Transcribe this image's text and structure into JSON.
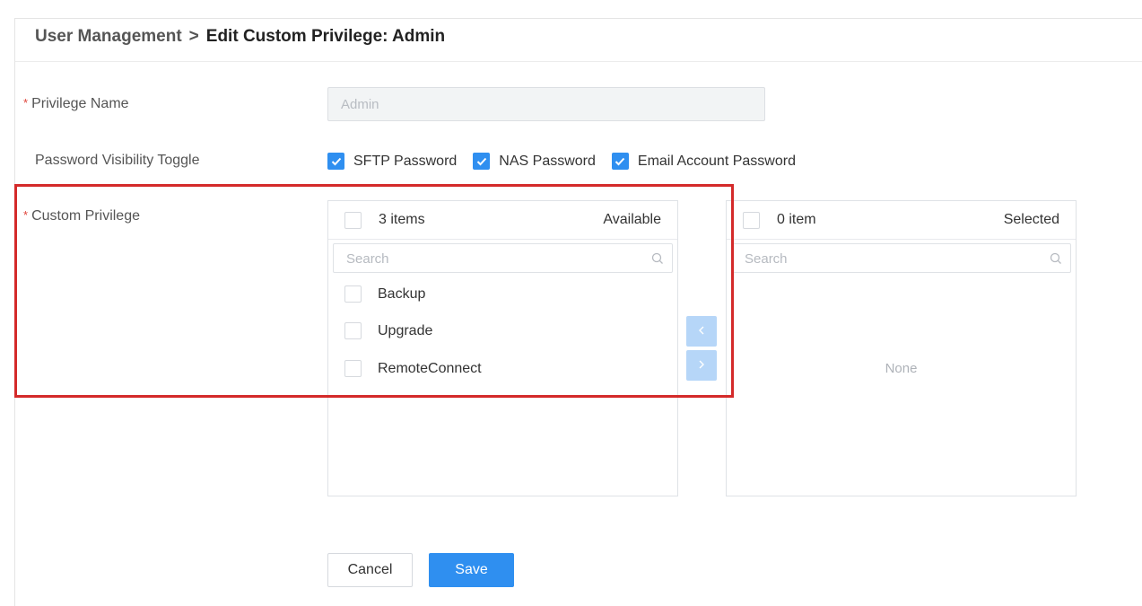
{
  "header": {
    "breadcrumb_parent": "User Management",
    "breadcrumb_separator": ">",
    "page_title": "Edit Custom Privilege: Admin"
  },
  "form": {
    "privilege_name": {
      "label": "Privilege Name",
      "required_mark": "*",
      "value": "Admin"
    },
    "password_visibility": {
      "label": "Password Visibility Toggle",
      "options": [
        {
          "label": "SFTP Password",
          "checked": true
        },
        {
          "label": "NAS Password",
          "checked": true
        },
        {
          "label": "Email Account Password",
          "checked": true
        }
      ]
    },
    "custom_privilege": {
      "label": "Custom Privilege",
      "required_mark": "*"
    }
  },
  "transfer": {
    "available": {
      "count": "3 items",
      "title": "Available",
      "search_placeholder": "Search",
      "items": [
        "Backup",
        "Upgrade",
        "RemoteConnect"
      ]
    },
    "selected": {
      "count": "0 item",
      "title": "Selected",
      "search_placeholder": "Search",
      "empty_text": "None"
    },
    "move_left_label": "<",
    "move_right_label": ">"
  },
  "actions": {
    "cancel_label": "Cancel",
    "save_label": "Save"
  },
  "colors": {
    "accent": "#2f8ff0",
    "highlight": "#d42a2a",
    "required": "#e0443a"
  }
}
